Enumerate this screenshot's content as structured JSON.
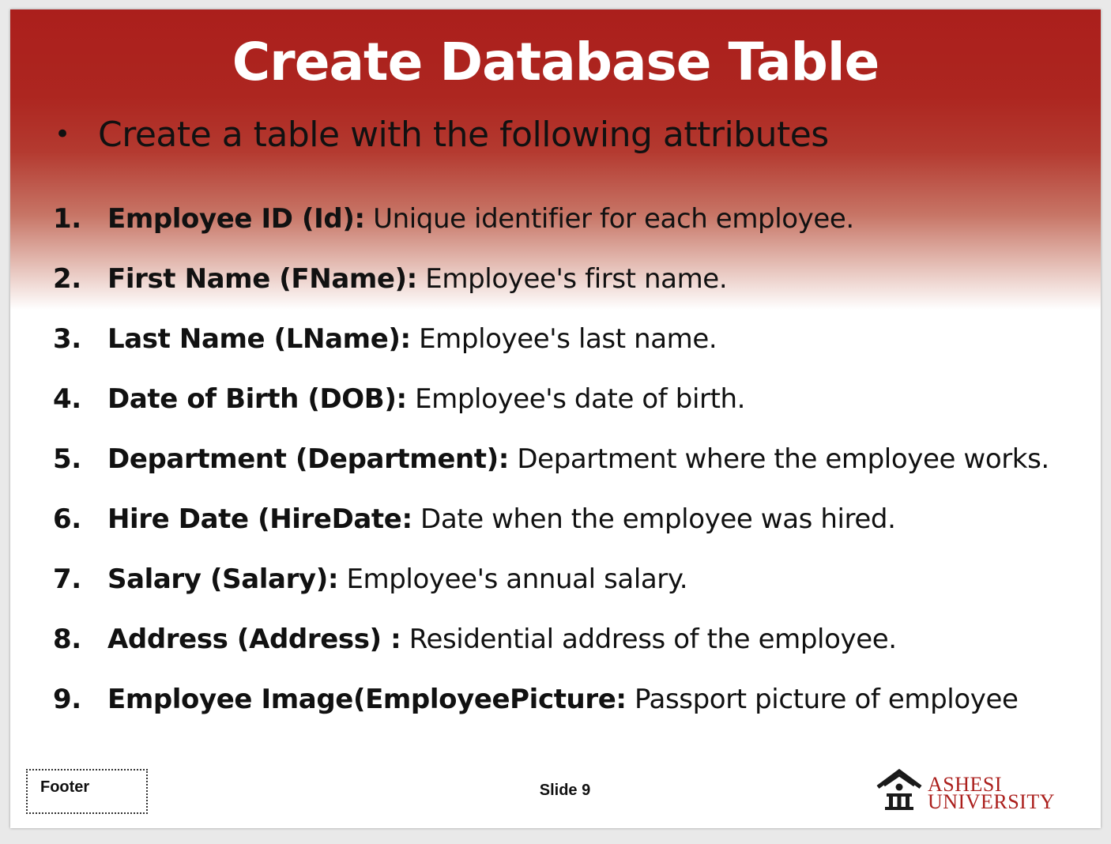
{
  "slide": {
    "title": "Create Database Table",
    "bullet": {
      "symbol": "•",
      "text": "Create a table with the following attributes"
    },
    "attributes": [
      {
        "number": "1.",
        "label": "Employee ID (Id):",
        "description": " Unique identifier for each employee."
      },
      {
        "number": "2.",
        "label": "First Name (FName):",
        "description": " Employee's first name."
      },
      {
        "number": "3.",
        "label": "Last Name (LName):",
        "description": " Employee's last name."
      },
      {
        "number": "4.",
        "label": "Date of Birth (DOB):",
        "description": " Employee's date of birth."
      },
      {
        "number": "5.",
        "label": "Department (Department):",
        "description": " Department where the employee works."
      },
      {
        "number": "6.",
        "label": "Hire Date (HireDate:",
        "description": " Date when the employee was hired."
      },
      {
        "number": "7.",
        "label": "Salary (Salary):",
        "description": " Employee's annual salary."
      },
      {
        "number": "8.",
        "label": "Address (Address) :",
        "description": " Residential address of the employee."
      },
      {
        "number": "9.",
        "label": "Employee Image(EmployeePicture:",
        "description": " Passport picture of employee"
      }
    ],
    "footer": "Footer",
    "slide_number": "Slide 9",
    "logo": {
      "line1": "ASHESI",
      "line2": "UNIVERSITY",
      "icon": "ashesi-crest-icon"
    }
  },
  "colors": {
    "header_red": "#ab1f1c",
    "text": "#111111",
    "title": "#ffffff",
    "background": "#e9e9e9"
  }
}
